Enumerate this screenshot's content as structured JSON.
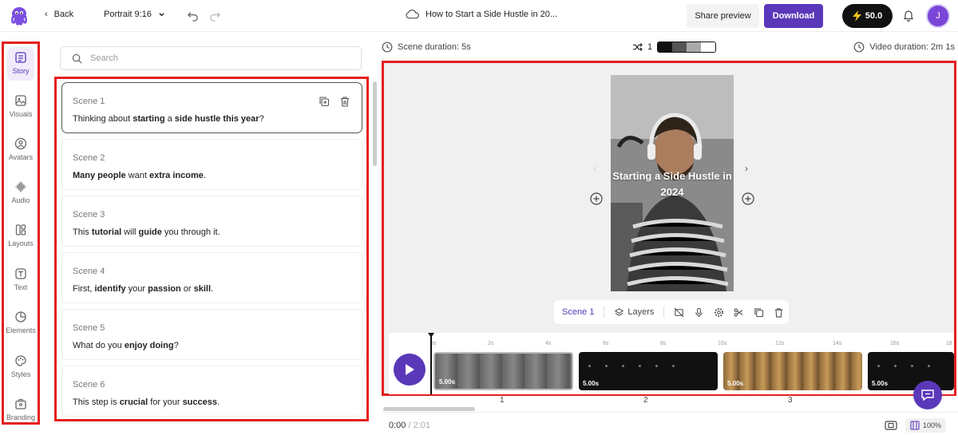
{
  "topbar": {
    "back_label": "Back",
    "aspect_label": "Portrait 9:16",
    "project_title": "How to Start a Side Hustle in 20...",
    "share_label": "Share preview",
    "download_label": "Download",
    "credits": "50.0",
    "avatar_initial": "J"
  },
  "sidebar": {
    "items": [
      {
        "label": "Story"
      },
      {
        "label": "Visuals"
      },
      {
        "label": "Avatars"
      },
      {
        "label": "Audio"
      },
      {
        "label": "Layouts"
      },
      {
        "label": "Text"
      },
      {
        "label": "Elements"
      },
      {
        "label": "Styles"
      },
      {
        "label": "Branding"
      }
    ]
  },
  "search": {
    "placeholder": "Search"
  },
  "scenes": [
    {
      "label": "Scene 1",
      "text_html": "Thinking about <b>starting</b> a <b>side hustle this year</b>?"
    },
    {
      "label": "Scene 2",
      "text_html": "<b>Many people</b> want <b>extra income</b>."
    },
    {
      "label": "Scene 3",
      "text_html": "This <b>tutorial</b> will <b>guide</b> you through it."
    },
    {
      "label": "Scene 4",
      "text_html": "First, <b>identify</b> your <b>passion</b> or <b>skill</b>."
    },
    {
      "label": "Scene 5",
      "text_html": "What do you <b>enjoy doing</b>?"
    },
    {
      "label": "Scene 6",
      "text_html": "This step is <b>crucial</b> for your <b>success</b>."
    }
  ],
  "preview": {
    "scene_duration": "Scene duration: 5s",
    "shuffle_count": "1",
    "video_duration": "Video duration: 2m 1s",
    "video_caption": "Starting a Side Hustle in 2024",
    "swatch_colors": [
      "#111111",
      "#555555",
      "#aaaaaa",
      "#ffffff"
    ]
  },
  "scene_toolbar": {
    "scene_label": "Scene 1",
    "layers_label": "Layers"
  },
  "timeline": {
    "ruler": [
      "0s",
      "2s",
      "4s",
      "6s",
      "8s",
      "10s",
      "12s",
      "14s",
      "16s",
      "18"
    ],
    "clips": [
      {
        "duration": "5.00s"
      },
      {
        "duration": "5.00s"
      },
      {
        "duration": "5.00s"
      },
      {
        "duration": "5.00s"
      }
    ],
    "scene_numbers": [
      "1",
      "2",
      "3"
    ]
  },
  "playback": {
    "current": "0:00",
    "total": "/ 2:01",
    "zoom": "100%"
  },
  "colors": {
    "accent": "#5a38b9",
    "highlight_border": "#e41f1f"
  }
}
